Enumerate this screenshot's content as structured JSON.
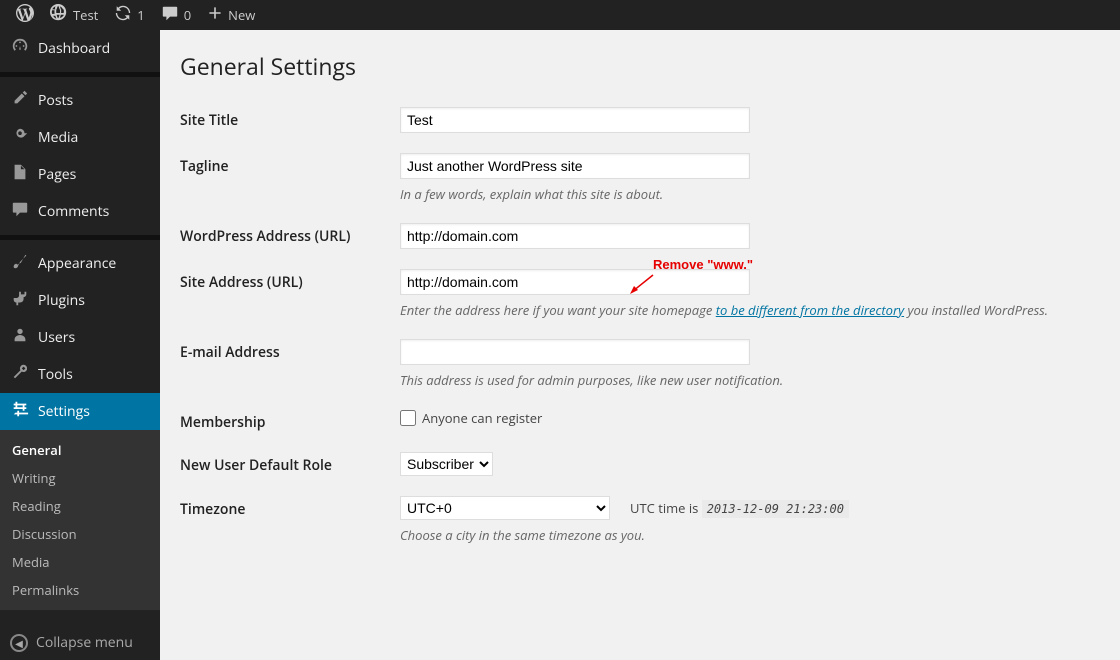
{
  "adminbar": {
    "site_name": "Test",
    "updates": "1",
    "comments": "0",
    "new": "New"
  },
  "sidebar": {
    "items": [
      {
        "label": "Dashboard"
      },
      {
        "label": "Posts"
      },
      {
        "label": "Media"
      },
      {
        "label": "Pages"
      },
      {
        "label": "Comments"
      },
      {
        "label": "Appearance"
      },
      {
        "label": "Plugins"
      },
      {
        "label": "Users"
      },
      {
        "label": "Tools"
      },
      {
        "label": "Settings"
      }
    ],
    "settings_sub": [
      {
        "label": "General"
      },
      {
        "label": "Writing"
      },
      {
        "label": "Reading"
      },
      {
        "label": "Discussion"
      },
      {
        "label": "Media"
      },
      {
        "label": "Permalinks"
      }
    ],
    "collapse": "Collapse menu"
  },
  "page": {
    "title": "General Settings",
    "site_title": {
      "label": "Site Title",
      "value": "Test"
    },
    "tagline": {
      "label": "Tagline",
      "value": "Just another WordPress site",
      "desc": "In a few words, explain what this site is about."
    },
    "wp_url": {
      "label": "WordPress Address (URL)",
      "value": "http://domain.com"
    },
    "site_url": {
      "label": "Site Address (URL)",
      "value": "http://domain.com",
      "desc_pre": "Enter the address here if you want your site homepage ",
      "desc_link": "to be different from the directory",
      "desc_post": " you installed WordPress."
    },
    "email": {
      "label": "E-mail Address",
      "value": "",
      "desc": "This address is used for admin purposes, like new user notification."
    },
    "membership": {
      "label": "Membership",
      "cb_label": "Anyone can register"
    },
    "role": {
      "label": "New User Default Role",
      "value": "Subscriber"
    },
    "timezone": {
      "label": "Timezone",
      "value": "UTC+0",
      "utc_pre": "UTC time is ",
      "utc_val": "2013-12-09 21:23:00",
      "desc": "Choose a city in the same timezone as you."
    }
  },
  "annotation": "Remove \"www.\""
}
